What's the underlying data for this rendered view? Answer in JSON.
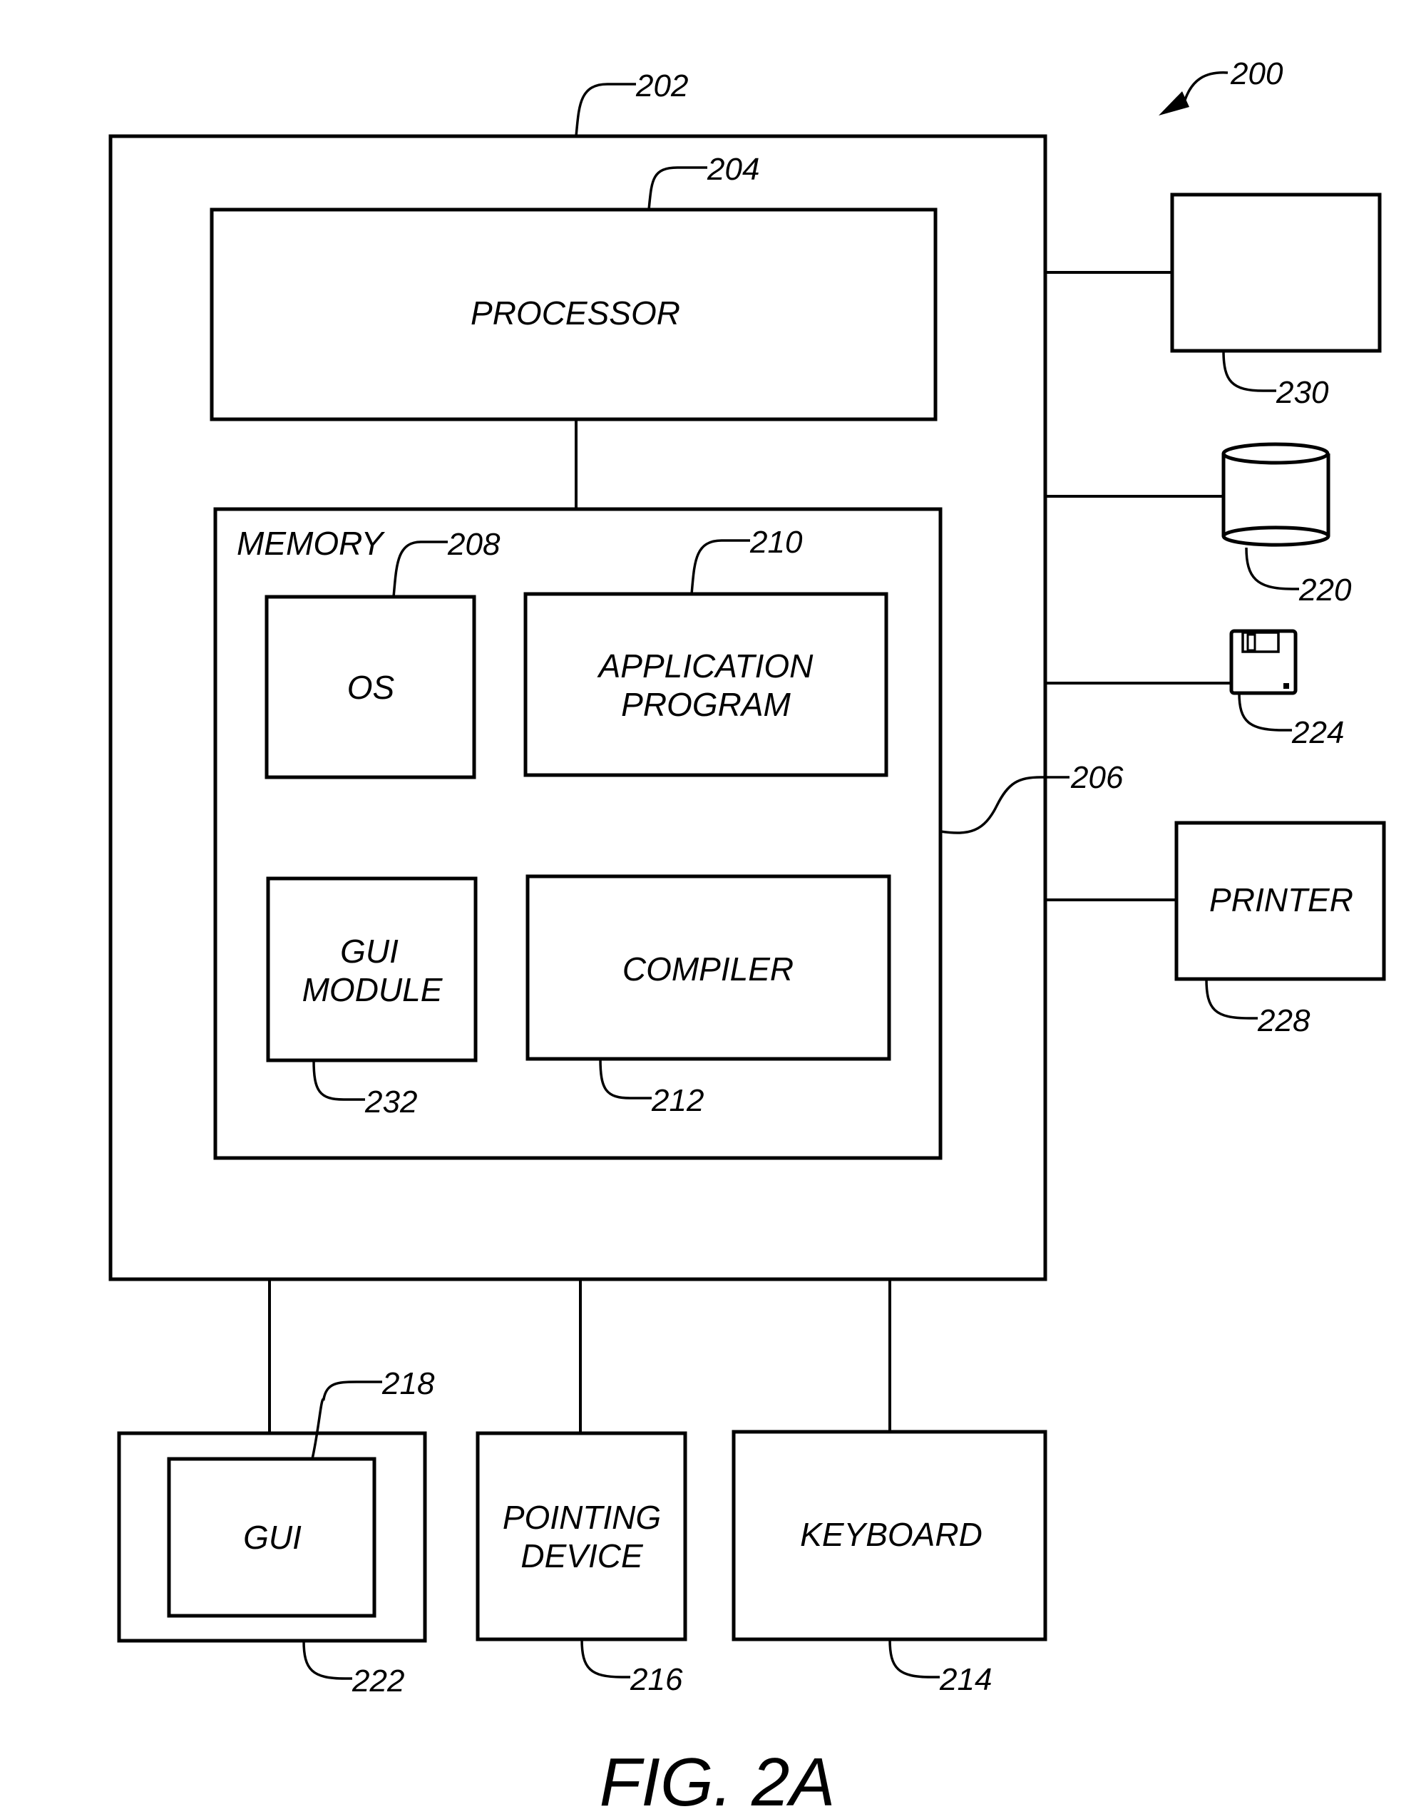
{
  "figure": {
    "caption": "FIG. 2A",
    "system_ref": "200"
  },
  "computer": {
    "ref": "202"
  },
  "processor": {
    "label": "PROCESSOR",
    "ref": "204"
  },
  "bus": {
    "ref": "206"
  },
  "memory": {
    "label": "MEMORY",
    "modules": {
      "os": {
        "label": "OS",
        "ref": "208"
      },
      "application": {
        "label_line1": "APPLICATION",
        "label_line2": "PROGRAM",
        "ref": "210"
      },
      "gui_module": {
        "label_line1": "GUI",
        "label_line2": "MODULE",
        "ref": "232"
      },
      "compiler": {
        "label": "COMPILER",
        "ref": "212"
      }
    }
  },
  "peripherals": {
    "monitor": {
      "ref": "230"
    },
    "storage_drum": {
      "ref": "220"
    },
    "floppy_disk": {
      "ref": "224"
    },
    "printer": {
      "label": "PRINTER",
      "ref": "228"
    },
    "display": {
      "ref": "222"
    },
    "gui": {
      "label": "GUI",
      "ref": "218"
    },
    "pointing_device": {
      "label_line1": "POINTING",
      "label_line2": "DEVICE",
      "ref": "216"
    },
    "keyboard": {
      "label": "KEYBOARD",
      "ref": "214"
    }
  }
}
